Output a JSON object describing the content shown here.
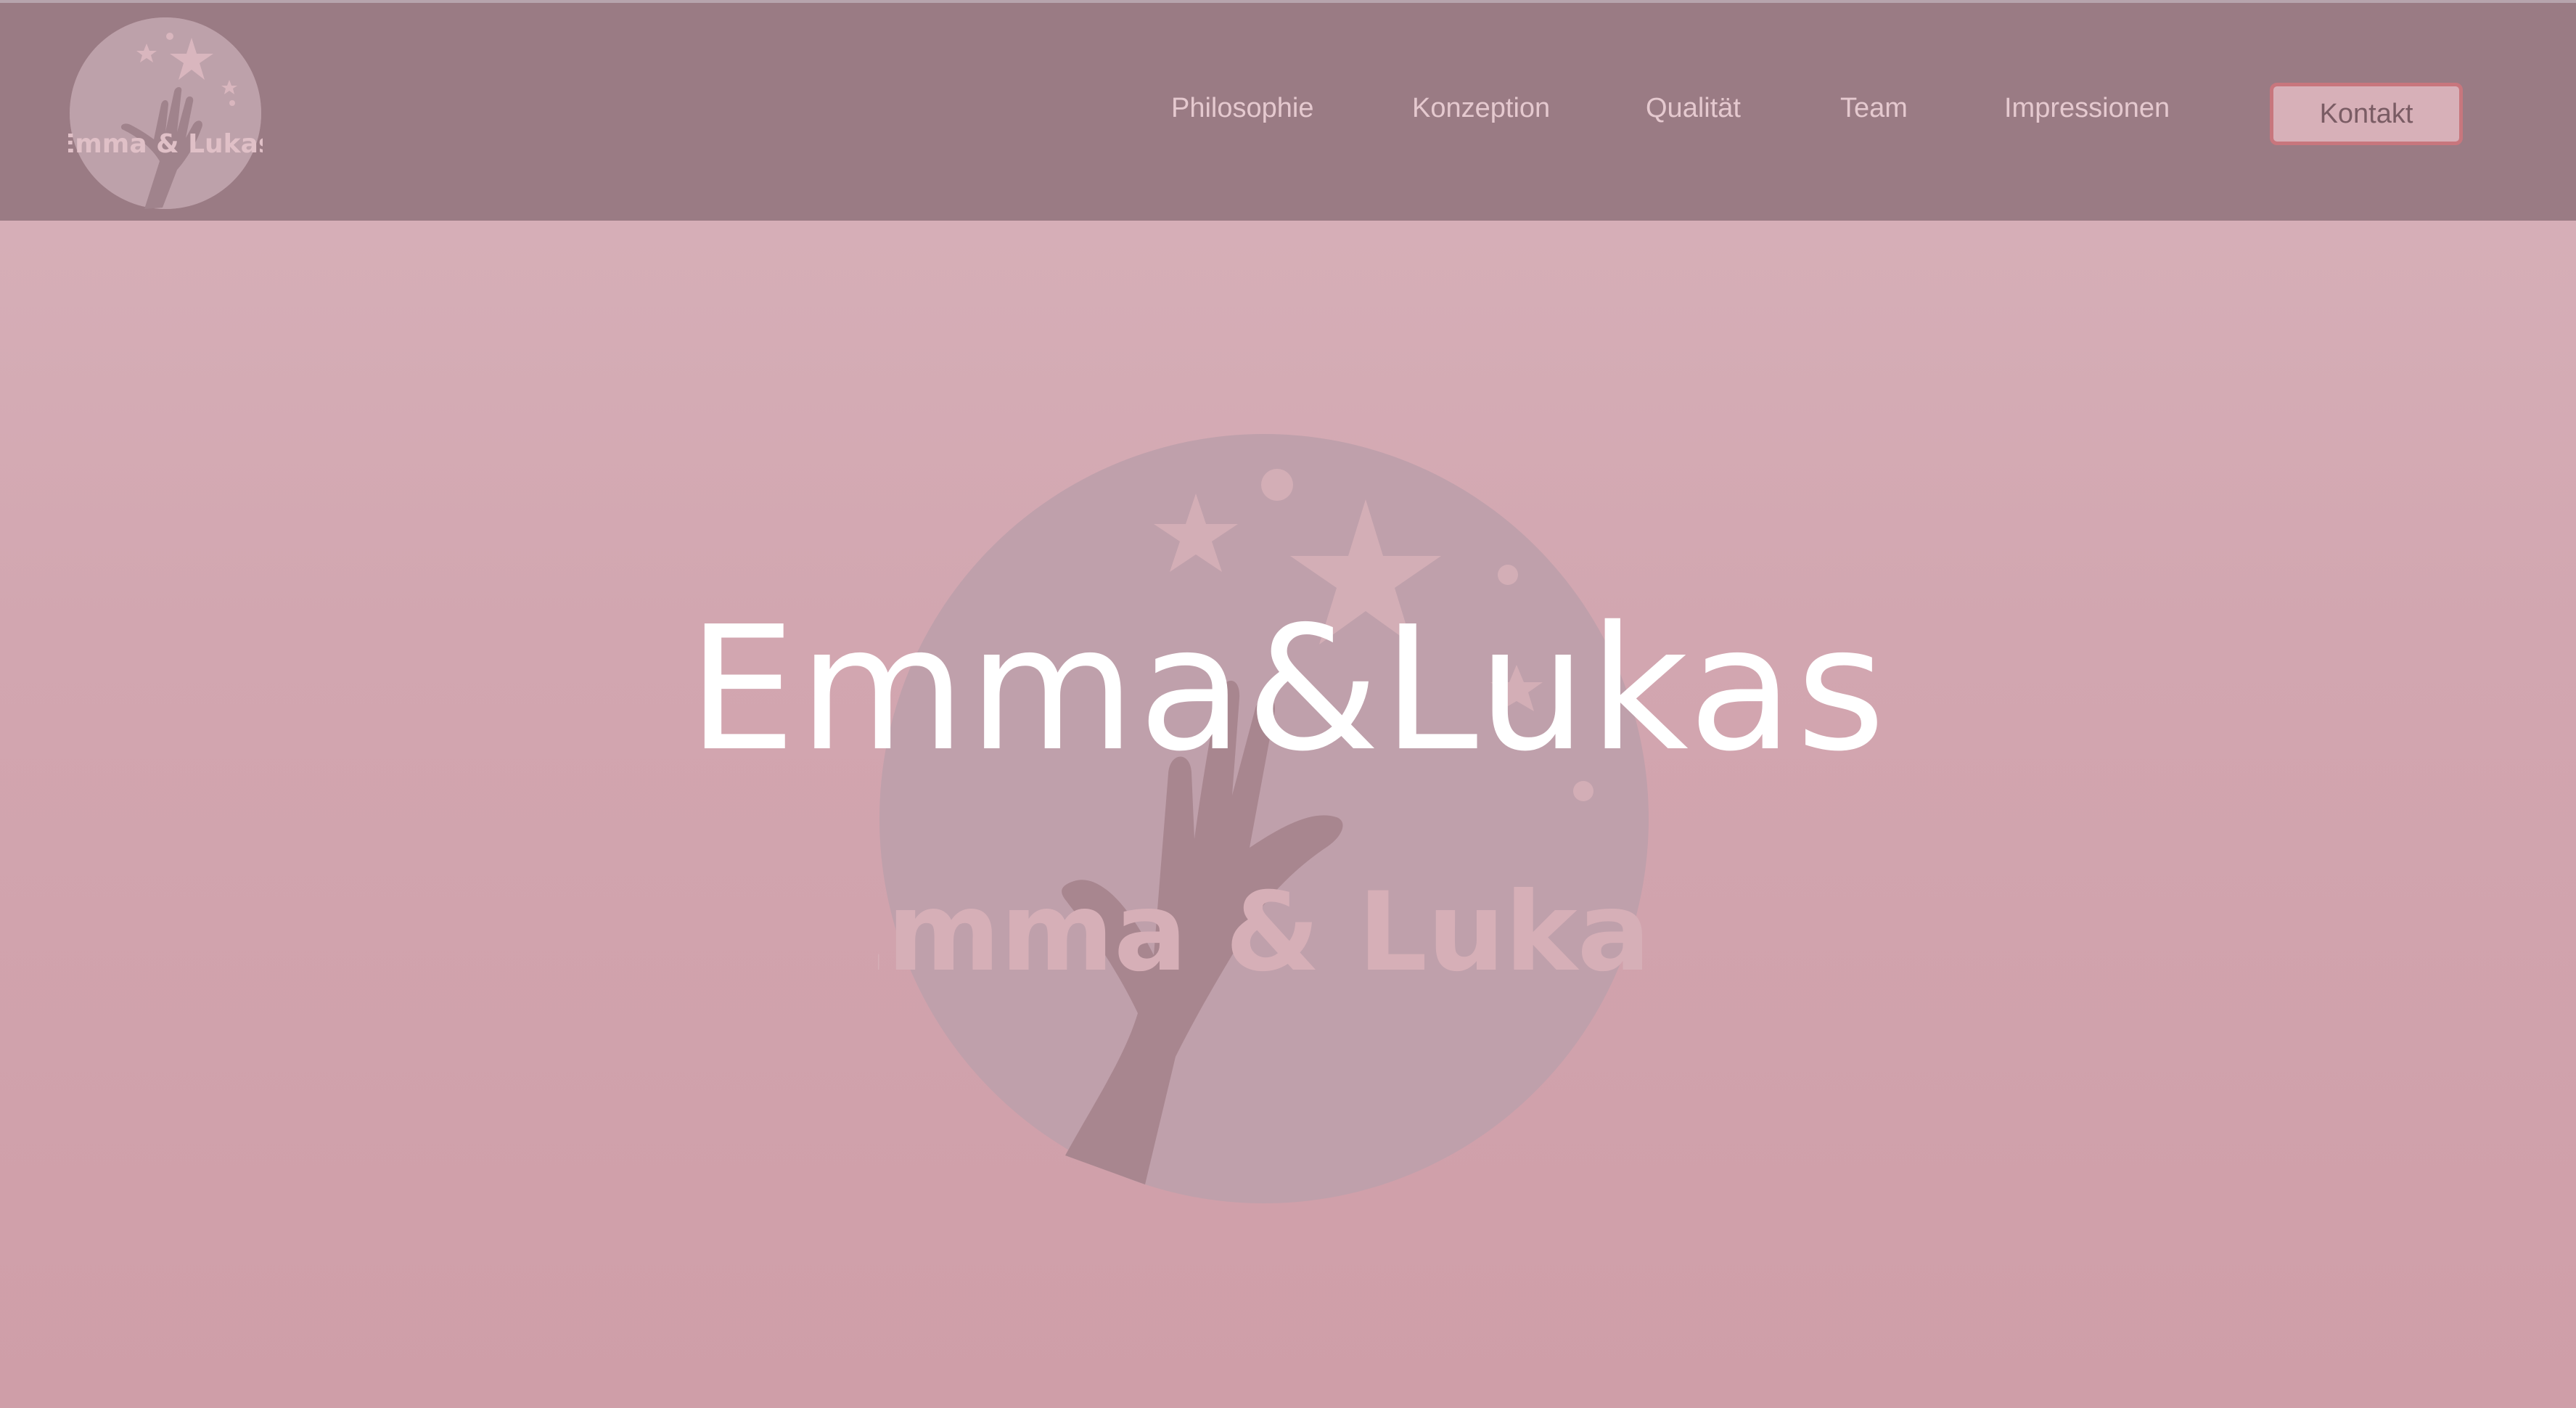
{
  "header": {
    "logo_text": "Emma & Lukas",
    "nav": [
      {
        "label": "Philosophie"
      },
      {
        "label": "Konzeption"
      },
      {
        "label": "Qualität"
      },
      {
        "label": "Team"
      },
      {
        "label": "Impressionen"
      }
    ],
    "cta_label": "Kontakt"
  },
  "hero": {
    "title": "Emma&Lukas",
    "logo_text": "Emma & Lukas"
  },
  "colors": {
    "header_bg": "#9a7b84",
    "hero_bg_top": "#d8b3bb",
    "hero_bg_bottom": "#cf9ea8",
    "nav_text": "#e5c9cf",
    "cta_border": "#c8767d",
    "title_text": "#ffffff"
  },
  "icons": [
    "logo-hand-stars",
    "hero-logo-hand-stars"
  ]
}
